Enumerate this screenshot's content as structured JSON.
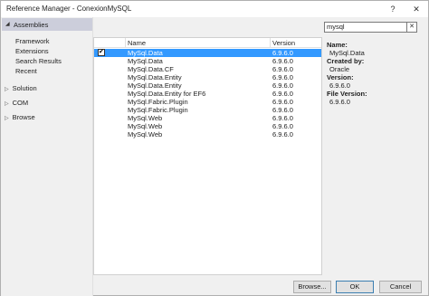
{
  "window": {
    "title": "Reference Manager - ConexionMySQL",
    "help_label": "?",
    "close_label": "✕"
  },
  "nav": {
    "header": "Assemblies",
    "sub_items": [
      "Framework",
      "Extensions",
      "Search Results",
      "Recent"
    ],
    "groups": [
      "Solution",
      "COM",
      "Browse"
    ]
  },
  "search": {
    "value": "mysql",
    "clear_label": "✕"
  },
  "list": {
    "columns": [
      "Name",
      "Version"
    ],
    "rows": [
      {
        "name": "MySql.Data",
        "version": "6.9.6.0",
        "checked": true,
        "selected": true
      },
      {
        "name": "MySql.Data",
        "version": "6.9.6.0"
      },
      {
        "name": "MySql.Data.CF",
        "version": "6.9.6.0"
      },
      {
        "name": "MySql.Data.Entity",
        "version": "6.9.6.0"
      },
      {
        "name": "MySql.Data.Entity",
        "version": "6.9.6.0"
      },
      {
        "name": "MySql.Data.Entity for EF6",
        "version": "6.9.6.0"
      },
      {
        "name": "MySql.Fabric.Plugin",
        "version": "6.9.6.0"
      },
      {
        "name": "MySql.Fabric.Plugin",
        "version": "6.9.6.0"
      },
      {
        "name": "MySql.Web",
        "version": "6.9.6.0"
      },
      {
        "name": "MySql.Web",
        "version": "6.9.6.0"
      },
      {
        "name": "MySql.Web",
        "version": "6.9.6.0"
      }
    ]
  },
  "details": {
    "name_label": "Name:",
    "name_value": "MySql.Data",
    "created_label": "Created by:",
    "created_value": "Oracle",
    "version_label": "Version:",
    "version_value": "6.9.6.0",
    "file_version_label": "File Version:",
    "file_version_value": "6.9.6.0"
  },
  "buttons": {
    "browse": "Browse...",
    "ok": "OK",
    "cancel": "Cancel"
  },
  "colors": {
    "selection": "#3399ff",
    "nav_header": "#cccedb"
  }
}
